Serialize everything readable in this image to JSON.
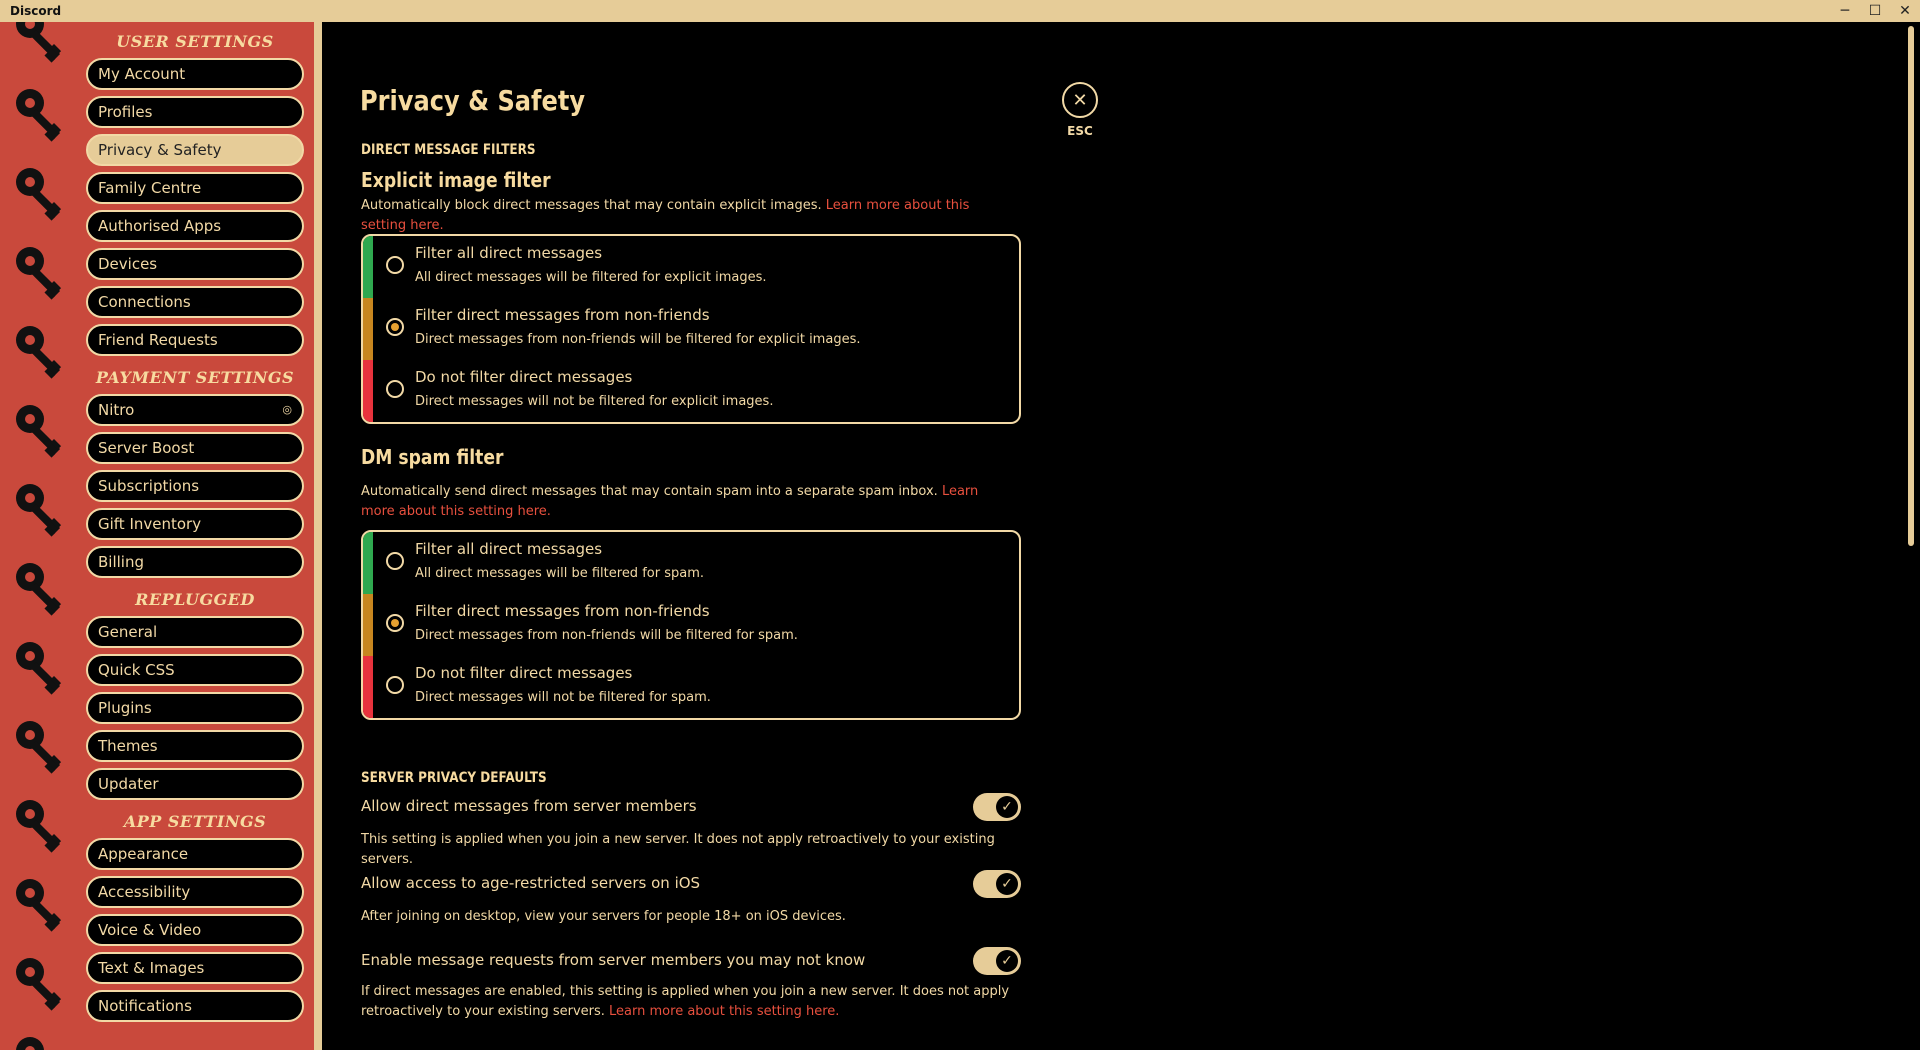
{
  "window": {
    "title": "Discord",
    "minimize": "─",
    "maximize": "☐",
    "close": "✕"
  },
  "sidebar": {
    "sections": [
      {
        "header": "USER SETTINGS",
        "items": [
          "My Account",
          "Profiles",
          "Privacy & Safety",
          "Family Centre",
          "Authorised Apps",
          "Devices",
          "Connections",
          "Friend Requests"
        ]
      },
      {
        "header": "PAYMENT SETTINGS",
        "items": [
          "Nitro",
          "Server Boost",
          "Subscriptions",
          "Gift Inventory",
          "Billing"
        ]
      },
      {
        "header": "REPLUGGED",
        "items": [
          "General",
          "Quick CSS",
          "Plugins",
          "Themes",
          "Updater"
        ]
      },
      {
        "header": "APP SETTINGS",
        "items": [
          "Appearance",
          "Accessibility",
          "Voice & Video",
          "Text & Images",
          "Notifications"
        ]
      }
    ],
    "active_item": "Privacy & Safety",
    "nitro_badge_icon": "nitro-badge-icon"
  },
  "main": {
    "title": "Privacy & Safety",
    "close_label": "ESC",
    "dm_filters_header": "DIRECT MESSAGE FILTERS",
    "explicit": {
      "title": "Explicit image filter",
      "desc": "Automatically block direct messages that may contain explicit images.",
      "link": "Learn more about this setting here.",
      "options": [
        {
          "label": "Filter all direct messages",
          "sub": "All direct messages will be filtered for explicit images.",
          "selected": false,
          "color": "#2fa84f"
        },
        {
          "label": "Filter direct messages from non-friends",
          "sub": "Direct messages from non-friends will be filtered for explicit images.",
          "selected": true,
          "color": "#c7861f"
        },
        {
          "label": "Do not filter direct messages",
          "sub": "Direct messages will not be filtered for explicit images.",
          "selected": false,
          "color": "#e8333d"
        }
      ]
    },
    "spam": {
      "title": "DM spam filter",
      "desc": "Automatically send direct messages that may contain spam into a separate spam inbox.",
      "link": "Learn more about this setting here.",
      "options": [
        {
          "label": "Filter all direct messages",
          "sub": "All direct messages will be filtered for spam.",
          "selected": false,
          "color": "#2fa84f"
        },
        {
          "label": "Filter direct messages from non-friends",
          "sub": "Direct messages from non-friends will be filtered for spam.",
          "selected": true,
          "color": "#c7861f"
        },
        {
          "label": "Do not filter direct messages",
          "sub": "Direct messages will not be filtered for spam.",
          "selected": false,
          "color": "#e8333d"
        }
      ]
    },
    "server_header": "SERVER PRIVACY DEFAULTS",
    "toggles": [
      {
        "label": "Allow direct messages from server members",
        "desc": "This setting is applied when you join a new server. It does not apply retroactively to your existing servers.",
        "on": true
      },
      {
        "label": "Allow access to age-restricted servers on iOS",
        "desc": "After joining on desktop, view your servers for people 18+ on iOS devices.",
        "on": true
      },
      {
        "label": "Enable message requests from server members you may not know",
        "desc": "If direct messages are enabled, this setting is applied when you join a new server. It does not apply retroactively to your existing servers.",
        "link": "Learn more about this setting here.",
        "on": true
      }
    ]
  }
}
